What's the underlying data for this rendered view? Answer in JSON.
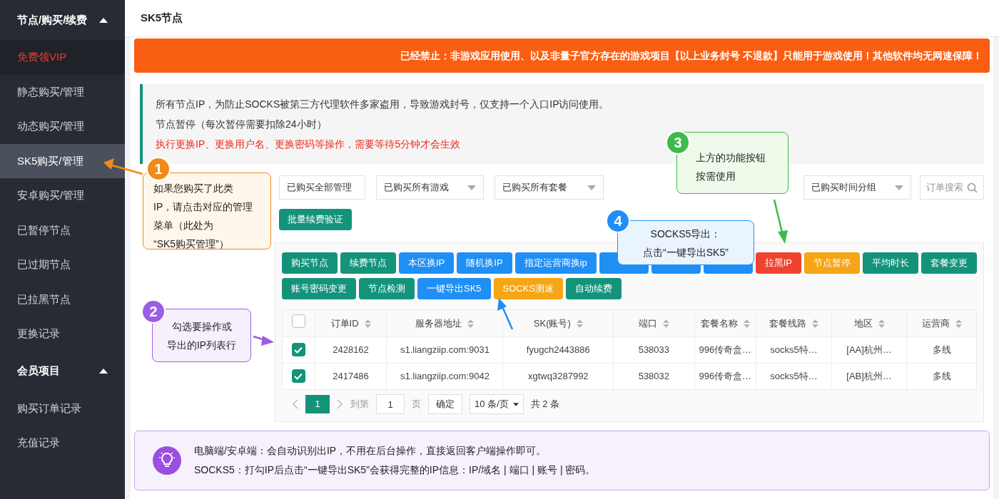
{
  "sidebar": {
    "groups": [
      {
        "title": "节点/购买/续费",
        "expanded": true,
        "items": [
          {
            "label": "免费领VIP",
            "kind": "promo",
            "selected": false
          },
          {
            "label": "静态购买/管理",
            "kind": "link",
            "selected": false
          },
          {
            "label": "动态购买/管理",
            "kind": "link",
            "selected": false
          },
          {
            "label": "SK5购买/管理",
            "kind": "link",
            "selected": true
          },
          {
            "label": "安卓购买/管理",
            "kind": "link",
            "selected": false
          },
          {
            "label": "已暂停节点",
            "kind": "link",
            "selected": false
          },
          {
            "label": "已过期节点",
            "kind": "link",
            "selected": false
          },
          {
            "label": "已拉黑节点",
            "kind": "link",
            "selected": false
          },
          {
            "label": "更换记录",
            "kind": "link",
            "selected": false
          }
        ]
      },
      {
        "title": "会员项目",
        "expanded": true,
        "items": [
          {
            "label": "购买订单记录",
            "kind": "link",
            "selected": false
          },
          {
            "label": "充值记录",
            "kind": "link",
            "selected": false
          }
        ]
      }
    ]
  },
  "page_title": "SK5节点",
  "banner": "已经禁止：非游戏应用使用、以及非量子官方存在的游戏项目【以上业务封号 不退款】只能用于游戏使用！其他软件均无网速保障！",
  "notice": [
    {
      "text": "所有节点IP，为防止SOCKS被第三方代理软件多家盗用，导致游戏封号，仅支持一个入口IP访问使用。",
      "kind": "normal"
    },
    {
      "text": "节点暂停（每次暂停需要扣除24小时）",
      "kind": "normal"
    },
    {
      "text": "执行更换IP、更换用户名、更换密码等操作，需要等待5分钟才会生效",
      "kind": "warning"
    }
  ],
  "filters": [
    {
      "value": "已购买全部管理",
      "dropdown": false
    },
    {
      "value": "已购买所有游戏",
      "dropdown": true
    },
    {
      "value": "已购买所有套餐",
      "dropdown": true
    }
  ],
  "time_filter": {
    "value": "已购买时间分组",
    "dropdown": true
  },
  "search": {
    "placeholder": "订单搜索"
  },
  "batch_button": "批量续费验证",
  "toolbar": [
    [
      {
        "label": "购买节点",
        "color": "#13937a"
      },
      {
        "label": "续费节点",
        "color": "#13937a"
      },
      {
        "label": "本区换IP",
        "color": "#1f8ff5"
      },
      {
        "label": "随机换IP",
        "color": "#1f8ff5"
      },
      {
        "label": "指定运营商换ip",
        "color": "#1f8ff5"
      },
      {
        "color": "#1f8ff5"
      },
      {
        "color": "#1f8ff5"
      },
      {
        "color": "#1f8ff5"
      },
      {
        "label": "拉黑IP",
        "color": "#f0432f"
      },
      {
        "label": "节点暂停",
        "color": "#f5a516"
      },
      {
        "label": "平均时长",
        "color": "#13937a"
      },
      {
        "label": "套餐变更",
        "color": "#13937a"
      }
    ],
    [
      {
        "label": "账号密码变更",
        "color": "#13937a"
      },
      {
        "label": "节点检测",
        "color": "#13937a"
      },
      {
        "label": "一键导出SK5",
        "color": "#1f8ff5"
      },
      {
        "label": "SOCKS测速",
        "color": "#f5a516"
      },
      {
        "label": "自动续费",
        "color": "#13937a"
      }
    ]
  ],
  "table": {
    "select_all": false,
    "columns": [
      "订单ID",
      "服务器地址",
      "SK(账号)",
      "端口",
      "套餐名称",
      "套餐线路",
      "地区",
      "运营商"
    ],
    "rows": [
      {
        "checked": true,
        "cells": [
          "2428162",
          "s1.liangziip.com:9031",
          "fyugch2443886",
          "538033",
          "996传奇盒…",
          "socks5特…",
          "[AA]杭州…",
          "多线"
        ]
      },
      {
        "checked": true,
        "cells": [
          "2417486",
          "s1.liangziip.com:9042",
          "xgtwq3287992",
          "538032",
          "996传奇盒…",
          "socks5特…",
          "[AB]杭州…",
          "多线"
        ]
      }
    ]
  },
  "pagination": {
    "pages": [
      {
        "label": "1",
        "selected": true
      }
    ],
    "goto_label": "到第",
    "goto_value": "1",
    "page_unit": "页",
    "confirm": "确定",
    "page_size": "10 条/页",
    "total": "共 2 条"
  },
  "tip": [
    "电脑端/安卓端：会自动识别出IP，不用在后台操作，直接返回客户端操作即可。",
    "SOCKS5：打勾IP后点击“一键导出SK5”会获得完整的IP信息：IP/域名 | 端口 | 账号 | 密码。"
  ],
  "callouts": [
    {
      "number": "1",
      "lines": [
        "如果您购买了此类",
        "IP，请点击对应的管理",
        "菜单（此处为",
        "“SK5购买管理”）"
      ],
      "color": "#f08a1c"
    },
    {
      "number": "2",
      "lines": [
        "勾选要操作或",
        "导出的IP列表行"
      ],
      "color": "#9b5de5"
    },
    {
      "number": "3",
      "lines": [
        "上方的功能按钮",
        "按需使用"
      ],
      "color": "#3dbb4a"
    },
    {
      "number": "4",
      "lines": [
        "SOCKS5导出：",
        "点击“一键导出SK5”"
      ],
      "color": "#1f8ff5"
    }
  ]
}
